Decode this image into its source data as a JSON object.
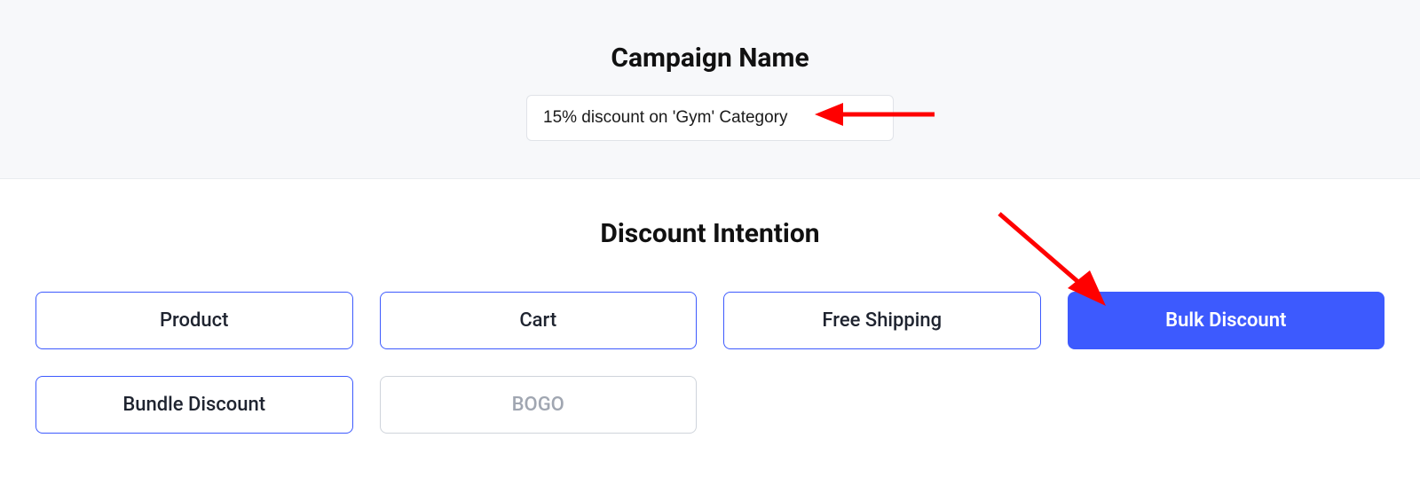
{
  "campaign": {
    "heading": "Campaign Name",
    "value": "15% discount on 'Gym' Category"
  },
  "intention": {
    "heading": "Discount Intention",
    "options": [
      {
        "label": "Product",
        "state": "default"
      },
      {
        "label": "Cart",
        "state": "default"
      },
      {
        "label": "Free Shipping",
        "state": "default"
      },
      {
        "label": "Bulk Discount",
        "state": "selected"
      },
      {
        "label": "Bundle Discount",
        "state": "default"
      },
      {
        "label": "BOGO",
        "state": "disabled"
      }
    ]
  },
  "annotation_color": "#ff0000"
}
